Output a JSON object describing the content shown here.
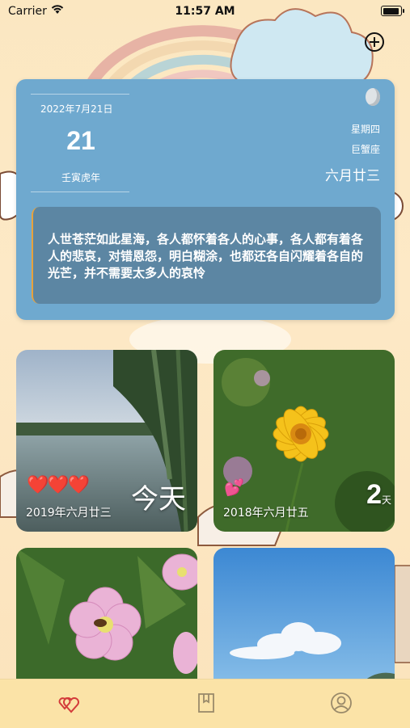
{
  "status_bar": {
    "carrier": "Carrier",
    "time": "11:57 AM"
  },
  "calendar": {
    "date": "2022年7月21日",
    "day": "21",
    "ganzhi": "壬寅虎年",
    "weekday": "星期四",
    "zodiac": "巨蟹座",
    "lunar_date": "六月廿三",
    "quote": "人世苍茫如此星海，各人都怀着各人的心事，各人都有着各人的悲哀，对错恩怨，明白糊涂，也都还各自闪耀着各自的光芒，并不需要太多人的哀怜"
  },
  "memories": [
    {
      "date": "2019年六月廿三",
      "count_label": "今天",
      "hearts": "❤️❤️❤️",
      "image": "lake-willow-photo"
    },
    {
      "date": "2018年六月廿五",
      "count": "2",
      "unit": "天",
      "hearts": "💕",
      "image": "yellow-coreopsis-photo"
    },
    {
      "date": "",
      "image": "pink-primrose-bee-photo"
    },
    {
      "date": "",
      "image": "blue-sky-cloud-photo"
    }
  ],
  "tabs": [
    {
      "name": "hearts",
      "icon": "hearts-icon",
      "active": true
    },
    {
      "name": "bookmark",
      "icon": "bookmark-book-icon",
      "active": false
    },
    {
      "name": "profile",
      "icon": "person-icon",
      "active": false
    }
  ],
  "colors": {
    "accent": "#d33a3a",
    "card_blue": "#6fa9cf",
    "quote_bg": "#5c86a3",
    "tabbar_bg": "#fbe3a7"
  }
}
